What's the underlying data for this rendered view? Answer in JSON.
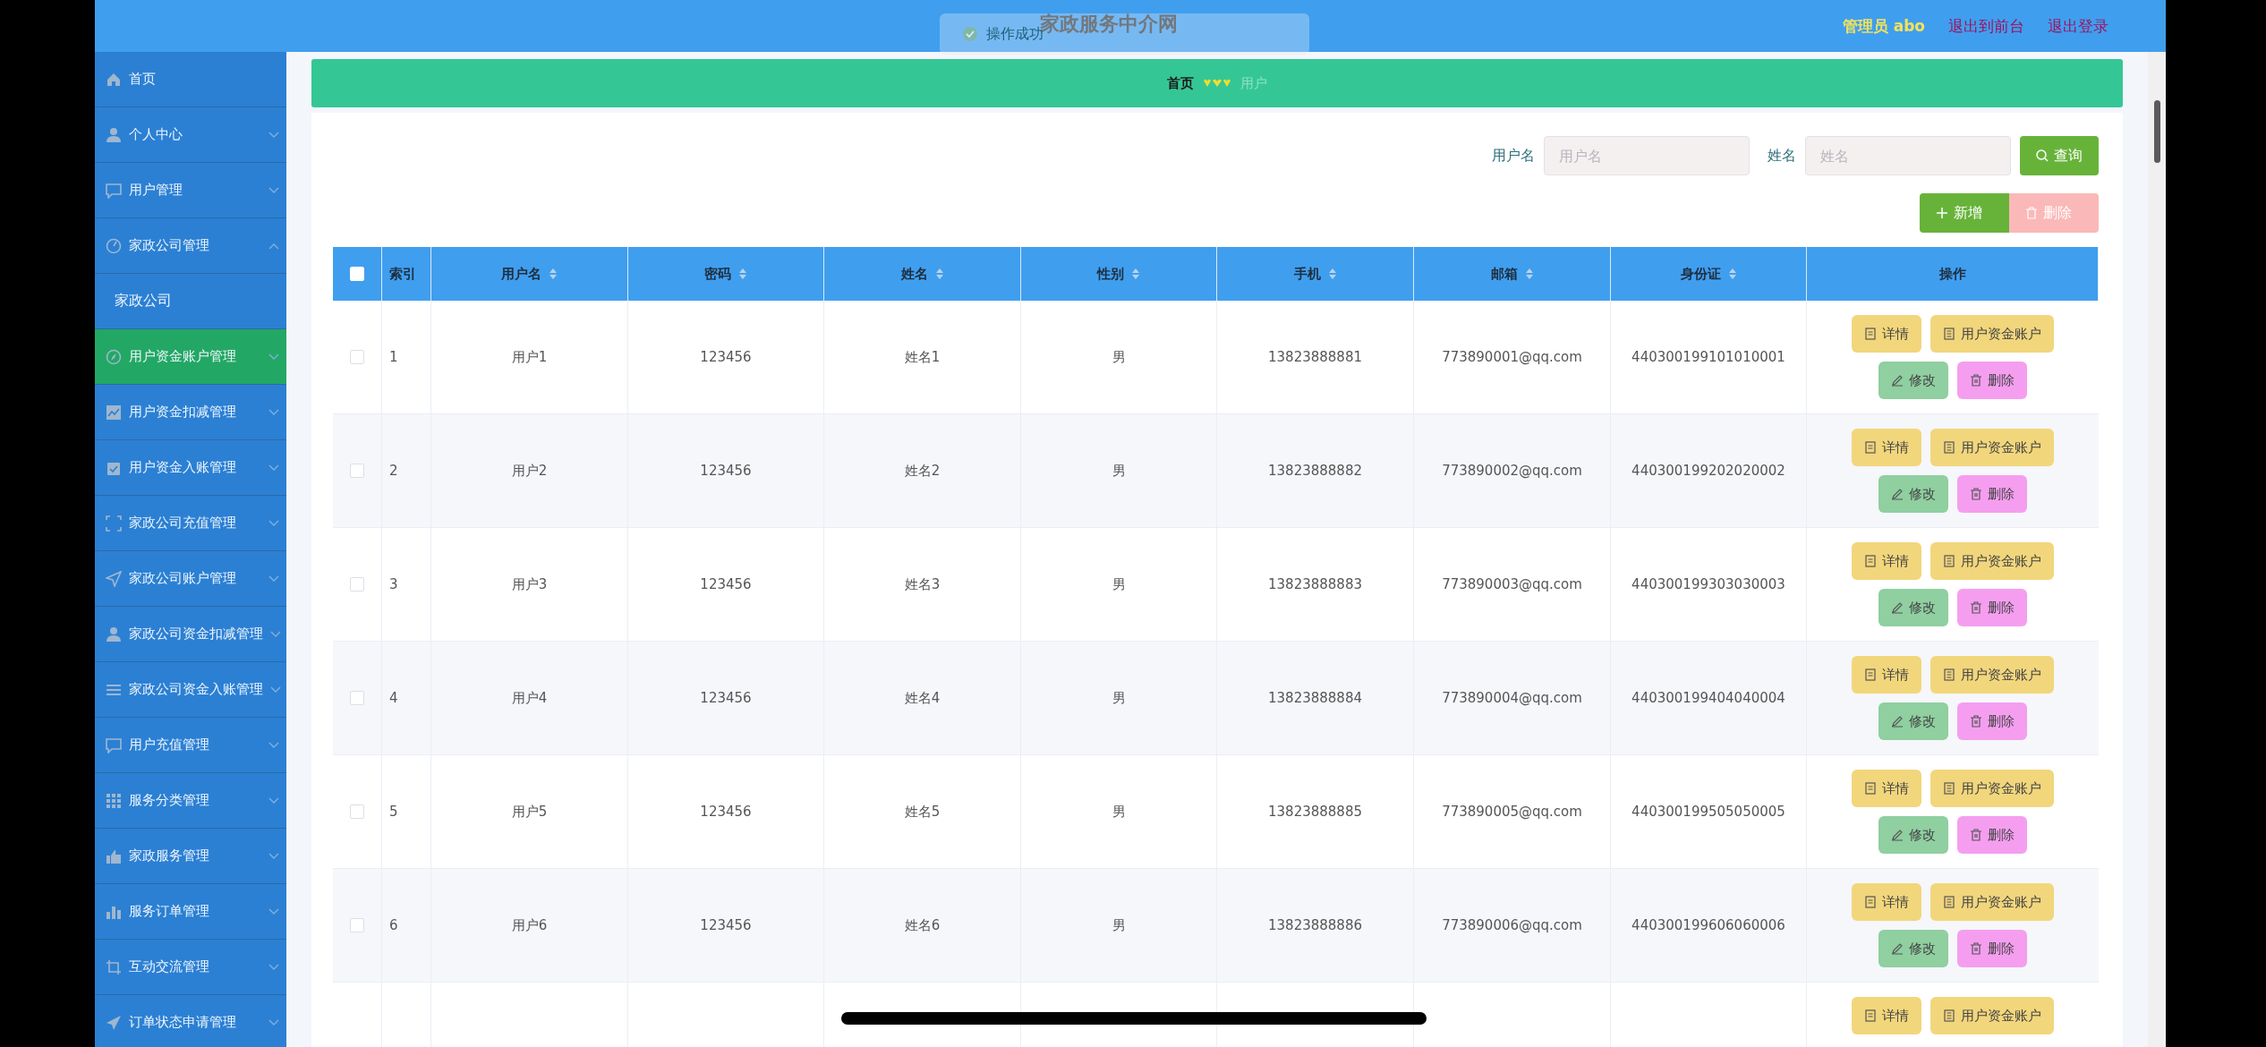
{
  "header": {
    "title": "家政服务中介网",
    "toast": "操作成功",
    "user": "管理员 abo",
    "links": [
      "退出到前台",
      "退出登录"
    ]
  },
  "sidebar": {
    "items": [
      {
        "label": "首页",
        "expandable": false,
        "selected": false
      },
      {
        "label": "个人中心",
        "expandable": true,
        "expanded": false,
        "selected": false
      },
      {
        "label": "用户管理",
        "expandable": true,
        "expanded": false,
        "selected": false
      },
      {
        "label": "家政公司管理",
        "expandable": true,
        "expanded": true,
        "selected": false,
        "children": [
          {
            "label": "家政公司"
          }
        ]
      },
      {
        "label": "用户资金账户管理",
        "expandable": true,
        "expanded": false,
        "selected": true
      },
      {
        "label": "用户资金扣减管理",
        "expandable": true,
        "expanded": false,
        "selected": false
      },
      {
        "label": "用户资金入账管理",
        "expandable": true,
        "expanded": false,
        "selected": false
      },
      {
        "label": "家政公司充值管理",
        "expandable": true,
        "expanded": false,
        "selected": false
      },
      {
        "label": "家政公司账户管理",
        "expandable": true,
        "expanded": false,
        "selected": false
      },
      {
        "label": "家政公司资金扣减管理",
        "expandable": true,
        "expanded": false,
        "selected": false
      },
      {
        "label": "家政公司资金入账管理",
        "expandable": true,
        "expanded": false,
        "selected": false
      },
      {
        "label": "用户充值管理",
        "expandable": true,
        "expanded": false,
        "selected": false
      },
      {
        "label": "服务分类管理",
        "expandable": true,
        "expanded": false,
        "selected": false
      },
      {
        "label": "家政服务管理",
        "expandable": true,
        "expanded": false,
        "selected": false
      },
      {
        "label": "服务订单管理",
        "expandable": true,
        "expanded": false,
        "selected": false
      },
      {
        "label": "互动交流管理",
        "expandable": true,
        "expanded": false,
        "selected": false
      },
      {
        "label": "订单状态申请管理",
        "expandable": true,
        "expanded": false,
        "selected": false
      }
    ]
  },
  "breadcrumb": [
    "首页",
    "用户"
  ],
  "search": {
    "fields": [
      {
        "label": "用户名",
        "placeholder": "用户名"
      },
      {
        "label": "姓名",
        "placeholder": "姓名"
      }
    ],
    "button": "查询"
  },
  "toolbar": [
    {
      "kind": "add",
      "label": "新增",
      "disabled": false
    },
    {
      "kind": "delete",
      "label": "删除",
      "disabled": true
    }
  ],
  "table": {
    "header_checked": false,
    "columns": [
      {
        "label": "索引",
        "sortable": false
      },
      {
        "label": "用户名",
        "sortable": true
      },
      {
        "label": "密码",
        "sortable": true
      },
      {
        "label": "姓名",
        "sortable": true
      },
      {
        "label": "性别",
        "sortable": true
      },
      {
        "label": "手机",
        "sortable": true
      },
      {
        "label": "邮箱",
        "sortable": true
      },
      {
        "label": "身份证",
        "sortable": true
      },
      {
        "label": "操作",
        "sortable": false
      }
    ],
    "rows": [
      {
        "checked": false,
        "cells": [
          "1",
          "用户1",
          "123456",
          "姓名1",
          "男",
          "13823888881",
          "773890001@qq.com",
          "440300199101010001"
        ],
        "actions": [
          {
            "kind": "detail",
            "label": "详情"
          },
          {
            "kind": "account",
            "label": "用户资金账户"
          },
          {
            "kind": "edit",
            "label": "修改"
          },
          {
            "kind": "delete",
            "label": "删除"
          }
        ]
      },
      {
        "checked": false,
        "cells": [
          "2",
          "用户2",
          "123456",
          "姓名2",
          "男",
          "13823888882",
          "773890002@qq.com",
          "440300199202020002"
        ],
        "actions": [
          {
            "kind": "detail",
            "label": "详情"
          },
          {
            "kind": "account",
            "label": "用户资金账户"
          },
          {
            "kind": "edit",
            "label": "修改"
          },
          {
            "kind": "delete",
            "label": "删除"
          }
        ]
      },
      {
        "checked": false,
        "cells": [
          "3",
          "用户3",
          "123456",
          "姓名3",
          "男",
          "13823888883",
          "773890003@qq.com",
          "440300199303030003"
        ],
        "actions": [
          {
            "kind": "detail",
            "label": "详情"
          },
          {
            "kind": "account",
            "label": "用户资金账户"
          },
          {
            "kind": "edit",
            "label": "修改"
          },
          {
            "kind": "delete",
            "label": "删除"
          }
        ]
      },
      {
        "checked": false,
        "cells": [
          "4",
          "用户4",
          "123456",
          "姓名4",
          "男",
          "13823888884",
          "773890004@qq.com",
          "440300199404040004"
        ],
        "actions": [
          {
            "kind": "detail",
            "label": "详情"
          },
          {
            "kind": "account",
            "label": "用户资金账户"
          },
          {
            "kind": "edit",
            "label": "修改"
          },
          {
            "kind": "delete",
            "label": "删除"
          }
        ]
      },
      {
        "checked": false,
        "cells": [
          "5",
          "用户5",
          "123456",
          "姓名5",
          "男",
          "13823888885",
          "773890005@qq.com",
          "440300199505050005"
        ],
        "actions": [
          {
            "kind": "detail",
            "label": "详情"
          },
          {
            "kind": "account",
            "label": "用户资金账户"
          },
          {
            "kind": "edit",
            "label": "修改"
          },
          {
            "kind": "delete",
            "label": "删除"
          }
        ]
      },
      {
        "checked": false,
        "cells": [
          "6",
          "用户6",
          "123456",
          "姓名6",
          "男",
          "13823888886",
          "773890006@qq.com",
          "440300199606060006"
        ],
        "actions": [
          {
            "kind": "detail",
            "label": "详情"
          },
          {
            "kind": "account",
            "label": "用户资金账户"
          },
          {
            "kind": "edit",
            "label": "修改"
          },
          {
            "kind": "delete",
            "label": "删除"
          }
        ]
      }
    ],
    "partial_row": {
      "actions": [
        {
          "kind": "detail",
          "label": "详情"
        },
        {
          "kind": "account",
          "label": "用户资金账户"
        }
      ]
    }
  }
}
